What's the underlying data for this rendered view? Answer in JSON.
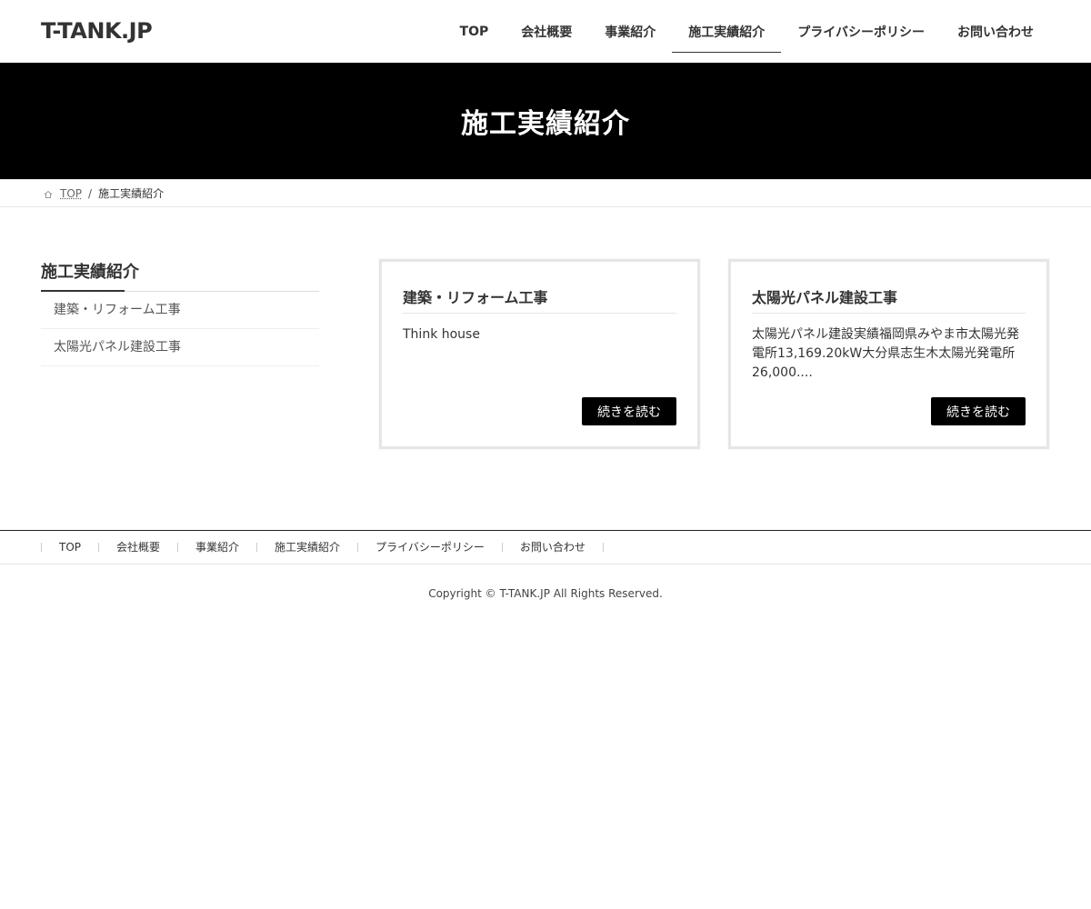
{
  "header": {
    "logo": "T-TANK.JP",
    "nav": [
      "TOP",
      "会社概要",
      "事業紹介",
      "施工実績紹介",
      "プライバシーポリシー",
      "お問い合わせ"
    ],
    "current": "施工実績紹介"
  },
  "page_header": {
    "title": "施工実績紹介"
  },
  "breadcrumb": {
    "home": "TOP",
    "separator": "/",
    "current": "施工実績紹介"
  },
  "sidebar": {
    "title": "施工実績紹介",
    "items": [
      "建築・リフォーム工事",
      "太陽光パネル建設工事"
    ]
  },
  "posts": [
    {
      "title": "建築・リフォーム工事",
      "excerpt": "Think house",
      "button": "続きを読む"
    },
    {
      "title": "太陽光パネル建設工事",
      "excerpt": "太陽光パネル建設実績福岡県みやま市太陽光発電所13,169.20kW大分県志生木太陽光発電所26,000....",
      "button": "続きを読む"
    }
  ],
  "footer": {
    "nav": [
      "TOP",
      "会社概要",
      "事業紹介",
      "施工実績紹介",
      "プライバシーポリシー",
      "お問い合わせ"
    ],
    "copyright": "Copyright © T-TANK.JP All Rights Reserved."
  },
  "colors": {
    "page_header_bg": "#000000",
    "button_bg": "#000000",
    "text": "#333333"
  }
}
